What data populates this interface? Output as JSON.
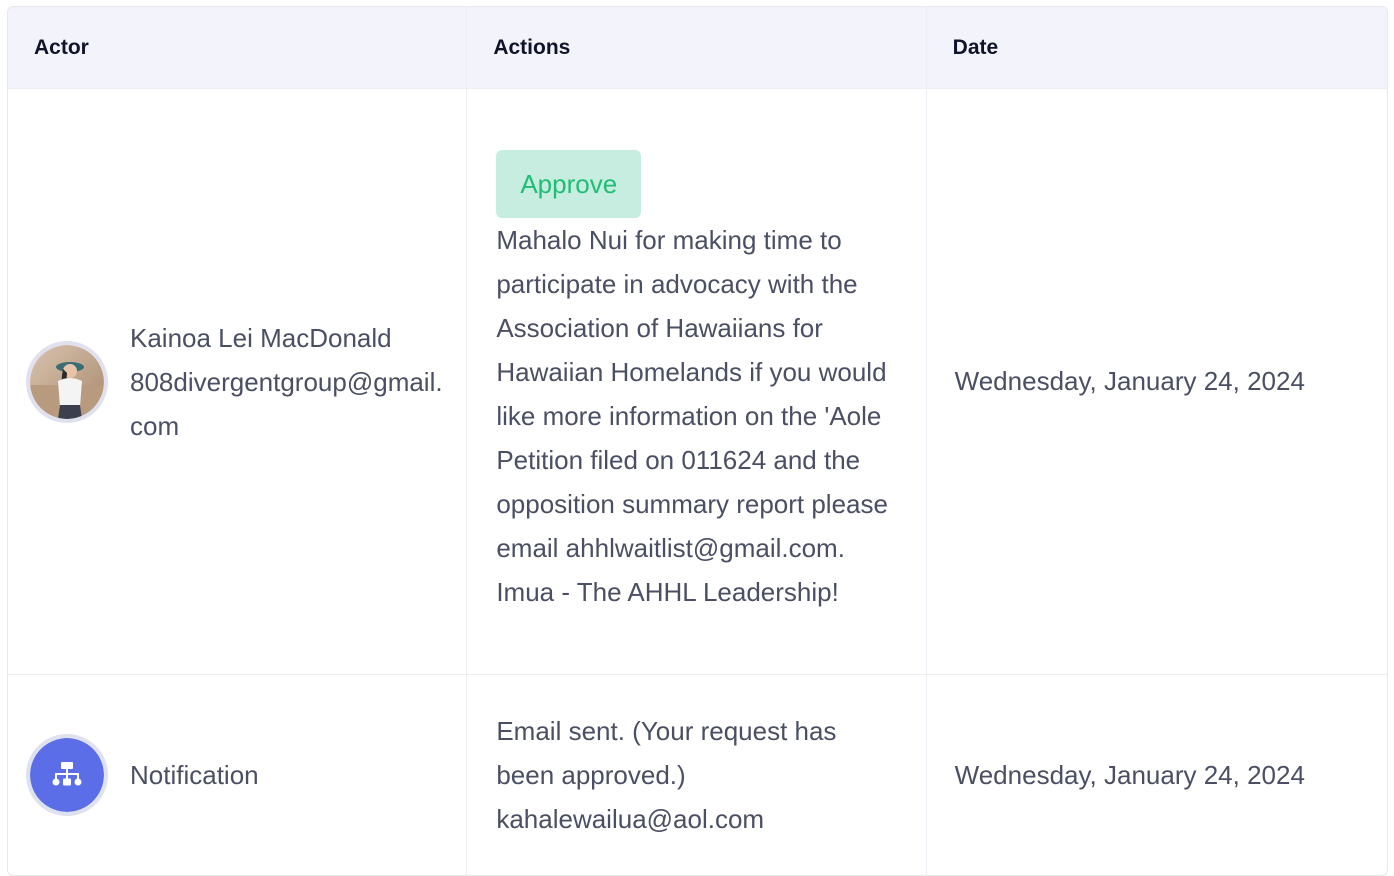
{
  "header": {
    "actor": "Actor",
    "actions": "Actions",
    "date": "Date"
  },
  "rows": [
    {
      "actor_name": "Kainoa Lei MacDonald",
      "actor_email": "808divergentgroup@gmail.com",
      "avatar": "user-photo",
      "action_button": "Approve",
      "action_text": "Mahalo Nui for making time to participate in advocacy with the Association of Hawaiians for Hawaiian Homelands if you would like more information on the 'Aole Petition filed on 011624 and the opposition summary report please email ahhlwaitlist@gmail.com. Imua - The AHHL Leadership!",
      "date": "Wednesday, January 24, 2024"
    },
    {
      "actor_name": "Notification",
      "avatar": "sitemap-icon",
      "action_text": "Email sent. (Your request has been approved.) kahalewailua@aol.com",
      "date": "Wednesday, January 24, 2024"
    }
  ],
  "colors": {
    "accent": "#5b6ee8",
    "approve_bg": "#c7ede0",
    "approve_text": "#21bd76",
    "header_bg": "#f3f4fb"
  }
}
